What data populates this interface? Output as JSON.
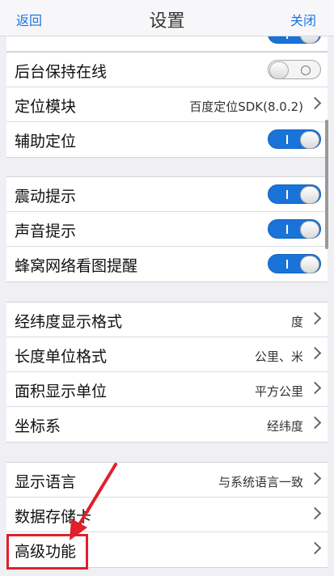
{
  "header": {
    "back_label": "返回",
    "title": "设置",
    "close_label": "关闭"
  },
  "groups": [
    {
      "rows": [
        {
          "label": "后台保持在线",
          "toggle": "off"
        },
        {
          "label": "定位模块",
          "value": "百度定位SDK(8.0.2)"
        },
        {
          "label": "辅助定位",
          "toggle": "on"
        }
      ]
    },
    {
      "rows": [
        {
          "label": "震动提示",
          "toggle": "on"
        },
        {
          "label": "声音提示",
          "toggle": "on"
        },
        {
          "label": "蜂窝网络看图提醒",
          "toggle": "on"
        }
      ]
    },
    {
      "rows": [
        {
          "label": "经纬度显示格式",
          "value": "度"
        },
        {
          "label": "长度单位格式",
          "value": "公里、米"
        },
        {
          "label": "面积显示单位",
          "value": "平方公里"
        },
        {
          "label": "坐标系",
          "value": "经纬度"
        }
      ]
    },
    {
      "rows": [
        {
          "label": "显示语言",
          "value": "与系统语言一致"
        },
        {
          "label": "数据存储卡"
        },
        {
          "label": "高级功能"
        }
      ]
    }
  ],
  "colors": {
    "accent": "#1a73e8",
    "toggle_on": "#1a73d8",
    "annotation": "#e0202a"
  }
}
